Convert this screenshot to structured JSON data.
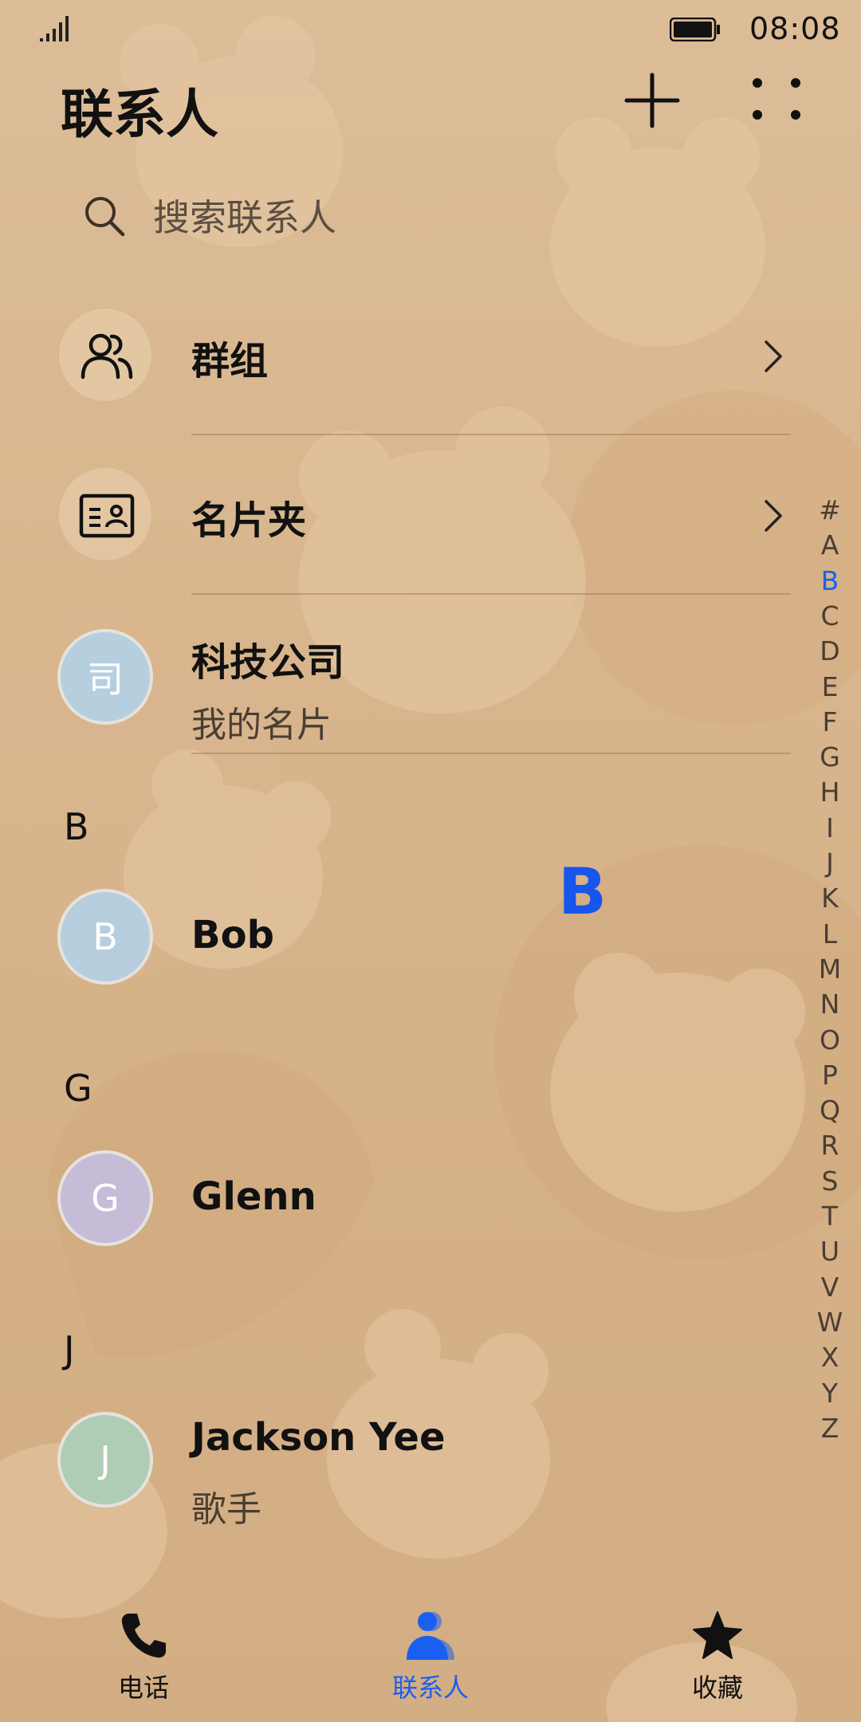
{
  "status_bar": {
    "time": "08:08"
  },
  "header": {
    "title": "联系人"
  },
  "search": {
    "placeholder": "搜索联系人"
  },
  "entries": [
    {
      "label": "群组",
      "icon": "group-icon"
    },
    {
      "label": "名片夹",
      "icon": "business-card-icon"
    }
  ],
  "my_card": {
    "avatar": "司",
    "name": "科技公司",
    "subtitle": "我的名片",
    "color": "#b5cfdf"
  },
  "contacts": [
    {
      "section": "B",
      "avatar": "B",
      "name": "Bob",
      "subtitle": "",
      "color": "#b6cede"
    },
    {
      "section": "G",
      "avatar": "G",
      "name": "Glenn",
      "subtitle": "",
      "color": "#c6bcd8"
    },
    {
      "section": "J",
      "avatar": "J",
      "name": "Jackson Yee",
      "subtitle": "歌手",
      "color": "#aecdb4"
    }
  ],
  "index_letters": [
    "#",
    "A",
    "B",
    "C",
    "D",
    "E",
    "F",
    "G",
    "H",
    "I",
    "J",
    "K",
    "L",
    "M",
    "N",
    "O",
    "P",
    "Q",
    "R",
    "S",
    "T",
    "U",
    "V",
    "W",
    "X",
    "Y",
    "Z"
  ],
  "index_active": "B",
  "letter_bubble": "B",
  "bottom_nav": [
    {
      "label": "电话",
      "icon": "phone-icon",
      "active": false
    },
    {
      "label": "联系人",
      "icon": "contacts-icon",
      "active": true
    },
    {
      "label": "收藏",
      "icon": "star-icon",
      "active": false
    }
  ],
  "colors": {
    "accent": "#1b5ff0",
    "background": "#d8b68c"
  }
}
